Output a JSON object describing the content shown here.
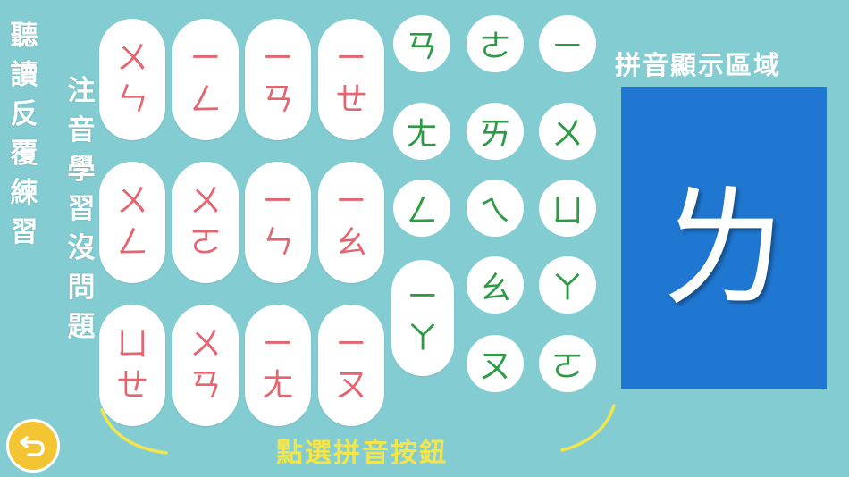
{
  "left_caption": "聽讀反覆練習",
  "mid_caption": "注音學習沒問題",
  "pink_pills": [
    [
      "ㄨ",
      "ㄣ"
    ],
    [
      "ㄧ",
      "ㄥ"
    ],
    [
      "ㄧ",
      "ㄢ"
    ],
    [
      "ㄧ",
      "ㄝ"
    ],
    [
      "ㄨ",
      "ㄥ"
    ],
    [
      "ㄨ",
      "ㄛ"
    ],
    [
      "ㄧ",
      "ㄣ"
    ],
    [
      "ㄧ",
      "ㄠ"
    ],
    [
      "ㄩ",
      "ㄝ"
    ],
    [
      "ㄨ",
      "ㄢ"
    ],
    [
      "ㄧ",
      "ㄤ"
    ],
    [
      "ㄧ",
      "ㄡ"
    ]
  ],
  "green_circles": [
    "ㄢ",
    "ㄜ",
    "ㄧ",
    "ㄤ",
    "ㄞ",
    "ㄨ",
    "ㄥ",
    "ㄟ",
    "ㄩ",
    "ㄠ",
    "ㄚ",
    "ㄡ",
    "ㄛ"
  ],
  "green_pill": [
    "ㄧ",
    "ㄚ"
  ],
  "display": {
    "title": "拼音顯示區域",
    "character": "ㄌ"
  },
  "tap_label": "點選拼音按鈕",
  "colors": {
    "background": "#83cdd2",
    "pink_text": "#e46470",
    "green_text": "#2d9b45",
    "display_bg": "#1f77d1",
    "accent_yellow": "#f3e54c"
  }
}
